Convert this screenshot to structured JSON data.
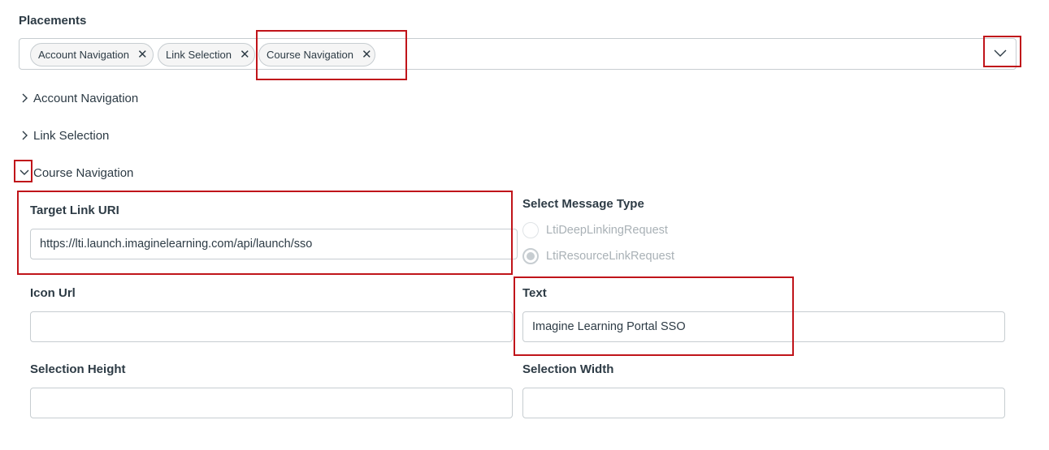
{
  "placements": {
    "label": "Placements",
    "tags": [
      {
        "label": "Account Navigation",
        "remove_icon": "close-icon"
      },
      {
        "label": "Link Selection",
        "remove_icon": "close-icon"
      },
      {
        "label": "Course Navigation",
        "remove_icon": "close-icon"
      }
    ],
    "dropdown_icon": "chevron-down-icon"
  },
  "sections": {
    "account_navigation": {
      "label": "Account Navigation",
      "expanded": false
    },
    "link_selection": {
      "label": "Link Selection",
      "expanded": false
    },
    "course_navigation": {
      "label": "Course Navigation",
      "expanded": true
    }
  },
  "course_navigation_form": {
    "target_link_uri": {
      "label": "Target Link URI",
      "value": "https://lti.launch.imaginelearning.com/api/launch/sso"
    },
    "message_type": {
      "label": "Select Message Type",
      "options": [
        {
          "label": "LtiDeepLinkingRequest",
          "selected": false
        },
        {
          "label": "LtiResourceLinkRequest",
          "selected": true
        }
      ]
    },
    "icon_url": {
      "label": "Icon Url",
      "value": ""
    },
    "text": {
      "label": "Text",
      "value": "Imagine Learning Portal SSO"
    },
    "selection_height": {
      "label": "Selection Height",
      "value": ""
    },
    "selection_width": {
      "label": "Selection Width",
      "value": ""
    }
  },
  "colors": {
    "highlight": "#c0141a",
    "border": "#c7cdd1",
    "text": "#2d3b45",
    "disabled_text": "#a9b1b6"
  }
}
